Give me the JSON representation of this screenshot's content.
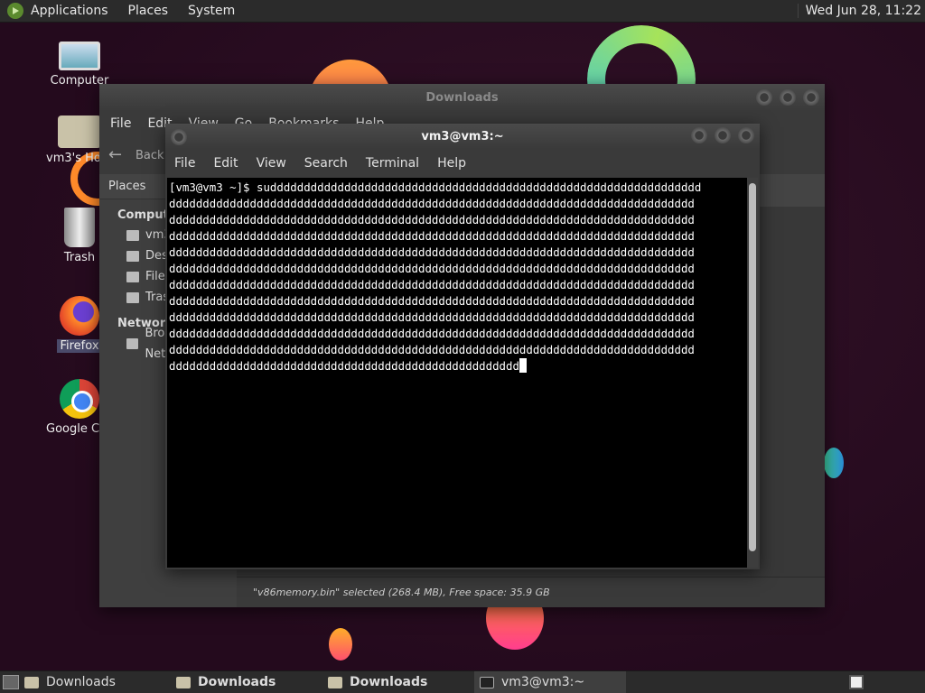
{
  "top_panel": {
    "menus": [
      "Applications",
      "Places",
      "System"
    ],
    "clock": "Wed Jun 28, 11:22"
  },
  "desktop_icons": [
    {
      "label": "Computer",
      "icon": "computer-icon"
    },
    {
      "label": "vm3's Home",
      "icon": "home-folder-icon"
    },
    {
      "label": "Trash",
      "icon": "trash-icon"
    },
    {
      "label": "Firefox",
      "icon": "firefox-icon"
    },
    {
      "label": "Google Chrome",
      "icon": "chrome-icon"
    }
  ],
  "downloads_window": {
    "title": "Downloads",
    "menus": [
      "File",
      "Edit",
      "View",
      "Go",
      "Bookmarks",
      "Help"
    ],
    "back_label": "Back",
    "sidebar_header": "Places",
    "sections": [
      {
        "title": "Computer",
        "items": [
          "vm3",
          "Desktop",
          "File System",
          "Trash"
        ]
      },
      {
        "title": "Network",
        "items": [
          "Browse Network"
        ]
      }
    ],
    "status": "\"v86memory.bin\" selected (268.4 MB), Free space: 35.9 GB"
  },
  "terminal_window": {
    "title": "vm3@vm3:~",
    "menus": [
      "File",
      "Edit",
      "View",
      "Search",
      "Terminal",
      "Help"
    ],
    "prompt": "[vm3@vm3 ~]$ ",
    "command_start": "su",
    "lines": [
      "dddddddddddddddddddddddddddddddddddddddddddddddddddddddddddddddd",
      "dddddddddddddddddddddddddddddddddddddddddddddddddddddddddddddddddddddddddddddd",
      "dddddddddddddddddddddddddddddddddddddddddddddddddddddddddddddddddddddddddddddd",
      "dddddddddddddddddddddddddddddddddddddddddddddddddddddddddddddddddddddddddddddd",
      "dddddddddddddddddddddddddddddddddddddddddddddddddddddddddddddddddddddddddddddd",
      "dddddddddddddddddddddddddddddddddddddddddddddddddddddddddddddddddddddddddddddd",
      "dddddddddddddddddddddddddddddddddddddddddddddddddddddddddddddddddddddddddddddd",
      "dddddddddddddddddddddddddddddddddddddddddddddddddddddddddddddddddddddddddddddd",
      "dddddddddddddddddddddddddddddddddddddddddddddddddddddddddddddddddddddddddddddd",
      "dddddddddddddddddddddddddddddddddddddddddddddddddddddddddddddddddddddddddddddd",
      "dddddddddddddddddddddddddddddddddddddddddddddddddddddddddddddddddddddddddddddd",
      "dddddddddddddddddddddddddddddddddddddddddddddddddddd"
    ]
  },
  "taskbar": [
    {
      "label": "Downloads",
      "bold": false,
      "icon": "folder-icon"
    },
    {
      "label": "Downloads",
      "bold": true,
      "icon": "folder-icon"
    },
    {
      "label": "Downloads",
      "bold": true,
      "icon": "folder-icon"
    },
    {
      "label": "vm3@vm3:~",
      "bold": false,
      "icon": "terminal-icon"
    }
  ]
}
